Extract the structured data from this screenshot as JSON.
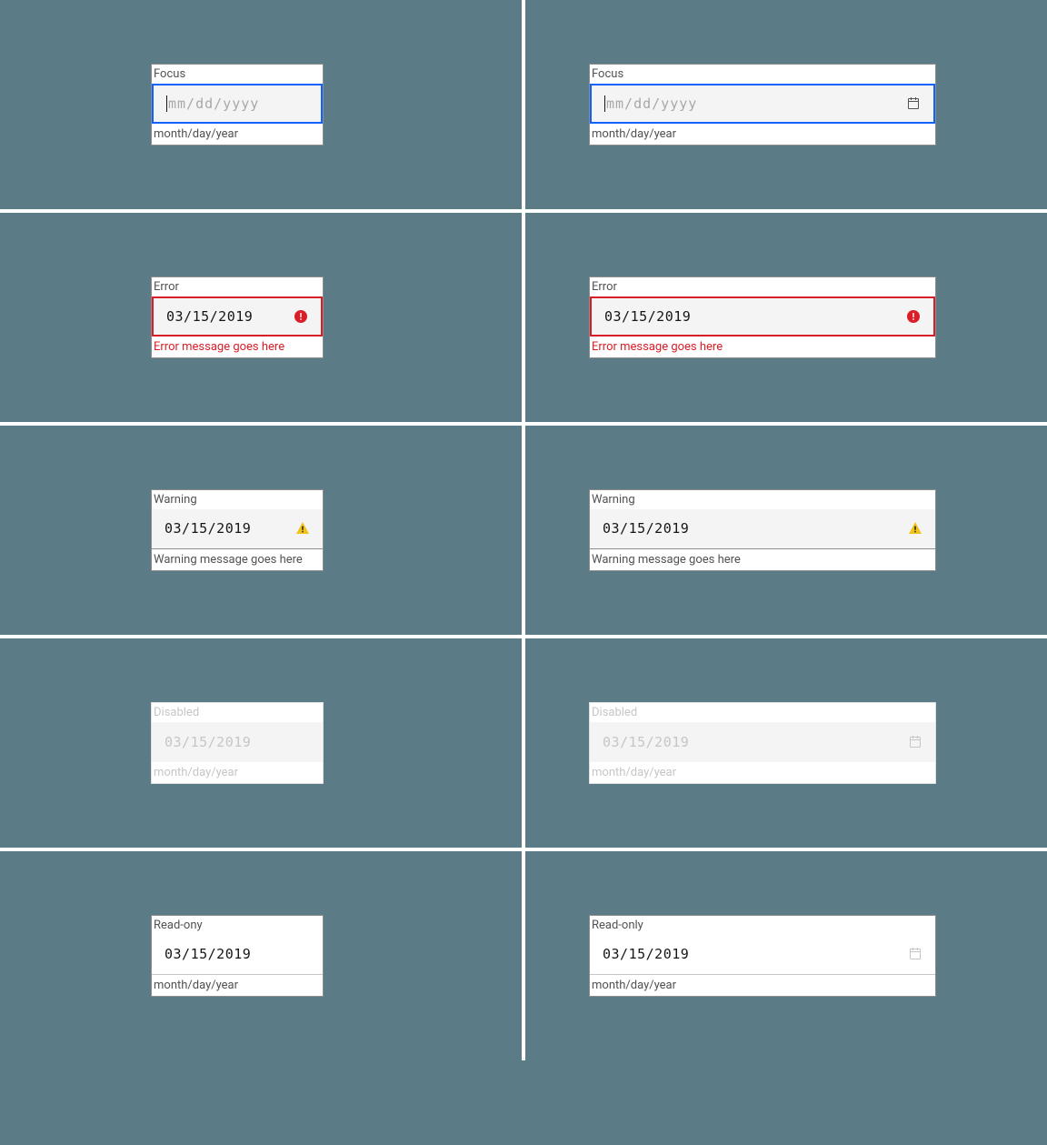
{
  "states": {
    "focus": {
      "label": "Focus",
      "placeholder": "mm/dd/yyyy",
      "helper": "month/day/year"
    },
    "error": {
      "label": "Error",
      "value": "03/15/2019",
      "helper": "Error message goes here"
    },
    "warning": {
      "label": "Warning",
      "value": "03/15/2019",
      "helper": "Warning message goes here"
    },
    "disabled": {
      "label": "Disabled",
      "value": "03/15/2019",
      "helper": "month/day/year"
    },
    "readonly_narrow": {
      "label": "Read-ony",
      "value": "03/15/2019",
      "helper": "month/day/year"
    },
    "readonly_wide": {
      "label": "Read-only",
      "value": "03/15/2019",
      "helper": "month/day/year"
    }
  },
  "icons": {
    "calendar": "calendar-icon",
    "error": "error-filled-icon",
    "warning": "warning-filled-icon"
  },
  "colors": {
    "focus_border": "#0f62fe",
    "error": "#da1e28",
    "warning": "#f1c21b",
    "background": "#5b7c86"
  }
}
